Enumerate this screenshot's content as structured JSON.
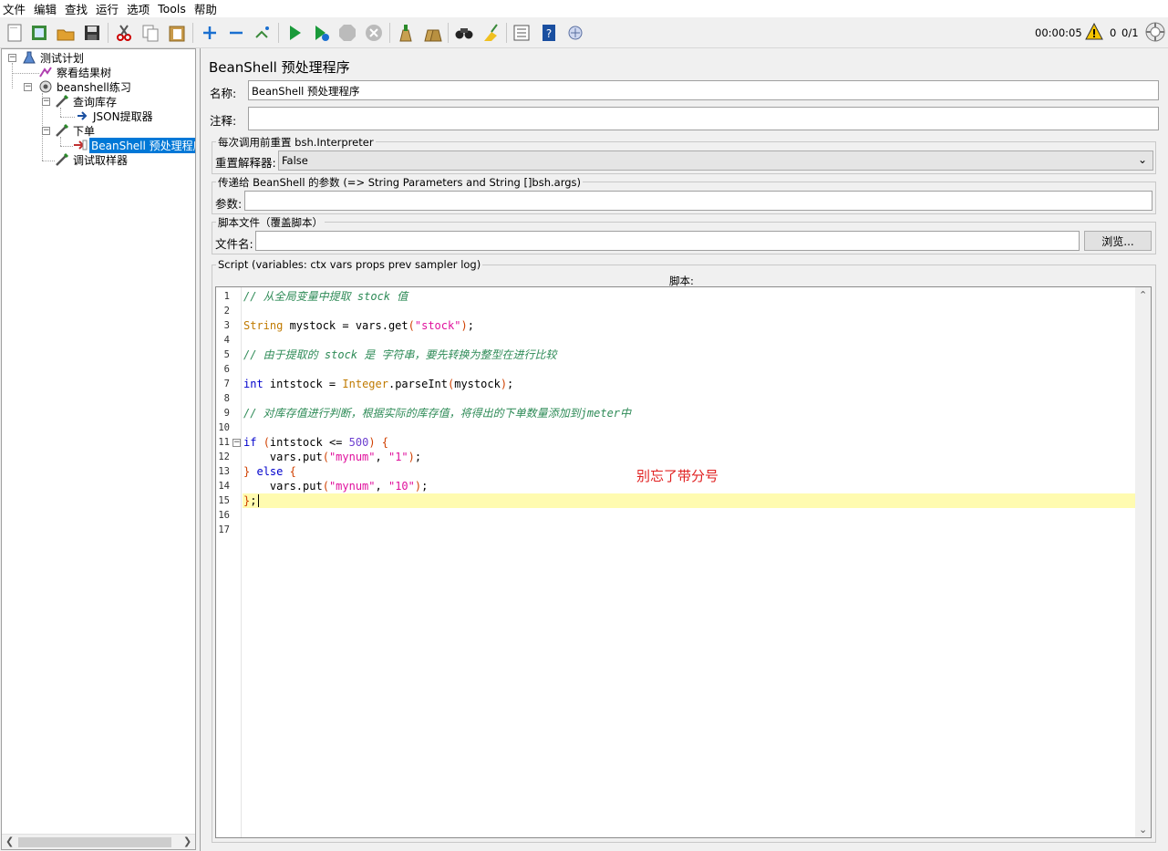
{
  "menubar": {
    "items": [
      "文件",
      "编辑",
      "查找",
      "运行",
      "选项",
      "Tools",
      "帮助"
    ]
  },
  "toolbar": {
    "buttons": [
      "new-icon",
      "templates-icon",
      "open-icon",
      "save-icon",
      "cut-icon",
      "copy-icon",
      "paste-icon",
      "expand-icon",
      "collapse-icon",
      "toggle-icon",
      "start-icon",
      "start-no-pause-icon",
      "stop-icon",
      "shutdown-icon",
      "clear-icon",
      "clear-all-icon",
      "search-icon",
      "reset-search-icon",
      "function-helper-icon",
      "help-icon",
      "remote-icon"
    ],
    "timer": "00:00:05",
    "error_count": "0",
    "threads": "0/1"
  },
  "tree": {
    "nodes": [
      {
        "label": "测试计划",
        "icon": "test-plan-icon"
      },
      {
        "label": "察看结果树",
        "icon": "listener-icon"
      },
      {
        "label": "beanshell练习",
        "icon": "thread-group-icon"
      },
      {
        "label": "查询库存",
        "icon": "sampler-icon"
      },
      {
        "label": "JSON提取器",
        "icon": "extractor-icon"
      },
      {
        "label": "下单",
        "icon": "sampler-icon"
      },
      {
        "label": "BeanShell 预处理程序",
        "icon": "preprocessor-icon"
      },
      {
        "label": "调试取样器",
        "icon": "sampler-icon"
      }
    ],
    "selected_index": 6
  },
  "editor": {
    "title": "BeanShell 预处理程序",
    "name_label": "名称:",
    "name_value": "BeanShell 预处理程序",
    "comment_label": "注释:",
    "comment_value": "",
    "reset_group_title": "每次调用前重置 bsh.Interpreter",
    "reset_label": "重置解释器:",
    "reset_value": "False",
    "params_group_title": "传递给 BeanShell 的参数 (=> String Parameters and String []bsh.args)",
    "params_label": "参数:",
    "params_value": "",
    "file_group_title": "脚本文件（覆盖脚本）",
    "file_label": "文件名:",
    "file_value": "",
    "browse_label": "浏览...",
    "script_group_title": "Script (variables: ctx vars props prev sampler log)",
    "script_label": "脚本:",
    "current_line": 15
  },
  "script": {
    "line_numbers": [
      "1",
      "2",
      "3",
      "4",
      "5",
      "6",
      "7",
      "8",
      "9",
      "10",
      "11",
      "12",
      "13",
      "14",
      "15",
      "16",
      "17"
    ],
    "lines": [
      "// 从全局变量中提取 stock 值",
      "",
      "String mystock = vars.get(\"stock\");",
      "",
      "// 由于提取的 stock 是 字符串，要先转换为整型在进行比较",
      "",
      "int intstock = Integer.parseInt(mystock);",
      "",
      "// 对库存值进行判断，根据实际的库存值，将得出的下单数量添加到jmeter中",
      "",
      "if (intstock <= 500) {",
      "    vars.put(\"mynum\", \"1\");",
      "} else {",
      "    vars.put(\"mynum\", \"10\");",
      "};",
      "",
      ""
    ]
  },
  "annotation": {
    "text": "别忘了带分号",
    "color": "#e02020"
  }
}
